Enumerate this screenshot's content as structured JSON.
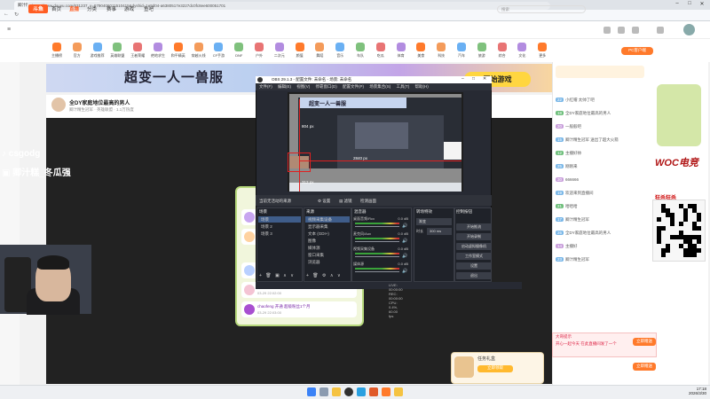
{
  "browser": {
    "tab_title": "卿汁精生冠军直播_卿汁精生冠军(冬...",
    "url": "https://www.douyu.com/631237_v=6790406011510415&dyshid=1e9d04-a6380517e3227dc0fc8ee600051701"
  },
  "site": {
    "logo": "斗鱼",
    "nav": [
      "首页",
      "直播",
      "分类",
      "赛事",
      "游戏",
      "鱼吧"
    ],
    "search_placeholder": "搜索",
    "pcbtn": "PC客户端"
  },
  "categories": [
    "主播榜",
    "官方",
    "游戏推荐",
    "英雄联盟",
    "王者荣耀",
    "绝地求生",
    "和平精英",
    "穿越火线",
    "CF手游",
    "DNF",
    "户外",
    "二次元",
    "颜值",
    "舞蹈",
    "音乐",
    "车队",
    "吃瓜",
    "体育",
    "美食",
    "科技",
    "汽车",
    "旅游",
    "综合",
    "文化",
    "更多"
  ],
  "banner": {
    "headline": "超变一人一兽服",
    "button": "开始游戏"
  },
  "room": {
    "title": "全DY家庭地位最高的男人",
    "subtitle": "卿汁精生冠军 · 英雄联盟 · 1.1万热度"
  },
  "stream_overlay": {
    "tiktok_handle": "csgodg",
    "name_tag": "卿汁糕_冬瓜强"
  },
  "obs": {
    "title": "OBS 29.1.3 - 配置文件: 未命名 - 场景: 未命名",
    "menu": "文件(F) 编辑(E) 视图(V) 停靠窗口(D) 配置文件(P) 场景集合(S) 工具(T) 帮助(H)",
    "preview_labels": [
      "804 px",
      "312 px",
      "2840 px"
    ],
    "toolbar": [
      "当前无活动的来源",
      "设置",
      "滤镜",
      "检测画面"
    ],
    "docks": {
      "scenes": {
        "title": "场景",
        "items": [
          "场景",
          "场景 2",
          "场景 3"
        ]
      },
      "sources": {
        "title": "来源",
        "items": [
          "视频采集设备",
          "显示器采集",
          "文本 (GDI+)",
          "图像",
          "媒体源",
          "窗口采集",
          "浏览器"
        ]
      },
      "mixer": {
        "title": "混音器",
        "items": [
          {
            "name": "桌面音频/Rcx",
            "db": "0.0 dB"
          },
          {
            "name": "麦克风/Aux",
            "db": "0.0 dB"
          },
          {
            "name": "视频采集设备",
            "db": "0.0 dB"
          },
          {
            "name": "媒体源",
            "db": "0.0 dB"
          }
        ]
      },
      "transitions": {
        "title": "转场特效",
        "fade": "渐变",
        "duration_label": "时长",
        "duration": "300 ms"
      },
      "controls": {
        "title": "控制按钮",
        "buttons": [
          "开始推流",
          "开始录制",
          "启动虚拟摄像机",
          "工作室模式",
          "设置",
          "退出"
        ]
      }
    },
    "status": "LIVE: 00:00:00   REC: 00:00:00   CPU: 0.4%, 60.00 fps"
  },
  "overlay_card": {
    "items": [
      {
        "text": "",
        "time": ""
      },
      {
        "text": "",
        "time": ""
      },
      {
        "text": "",
        "time": "03-29 21:02:00"
      },
      {
        "text": "",
        "time": "03-29 22:02:00"
      },
      {
        "text": "chaofeng 开通 超级粉丝1个月",
        "time": "03-29 22:03:00"
      }
    ]
  },
  "chat": {
    "lines": [
      {
        "badge": "22",
        "badge_class": "",
        "text": "小红帽 太帅了吧"
      },
      {
        "badge": "18",
        "badge_class": "g",
        "text": "全DY家庭地位最高的男人"
      },
      {
        "badge": "20",
        "badge_class": "p",
        "text": "一般般吧"
      },
      {
        "badge": "15",
        "badge_class": "",
        "text": "卿汁精生冠军 送出了超大火箭"
      },
      {
        "badge": "12",
        "badge_class": "g",
        "text": "主播好帅"
      },
      {
        "badge": "25",
        "badge_class": "",
        "text": "刚刚来"
      },
      {
        "badge": "30",
        "badge_class": "p",
        "text": "666666"
      },
      {
        "badge": "19",
        "badge_class": "",
        "text": "欢迎来到直播间"
      },
      {
        "badge": "21",
        "badge_class": "g",
        "text": "哈哈哈"
      },
      {
        "badge": "17",
        "badge_class": "",
        "text": "卿汁精生冠军"
      },
      {
        "badge": "26",
        "badge_class": "",
        "text": "全DY家庭地位最高的男人"
      },
      {
        "badge": "14",
        "badge_class": "p",
        "text": "主播好"
      },
      {
        "badge": "23",
        "badge_class": "",
        "text": "卿汁精生冠军"
      }
    ],
    "gift_tip_title": "大哥提示",
    "gift_tip_text": "开心一起今天 在此直播间发了一个",
    "send": "立即赠送"
  },
  "ad": {
    "woc_text": "WOC电竞",
    "qr_title": "狂杀狂杀"
  },
  "giftbox": {
    "title": "任务礼盒",
    "button": "立即领取"
  },
  "taskbar": {
    "time": "17:18",
    "date": "2026/3/30"
  },
  "colors": {
    "accent": "#ff5d23",
    "obs_bg": "#272a33",
    "red_line": "#e02020"
  }
}
